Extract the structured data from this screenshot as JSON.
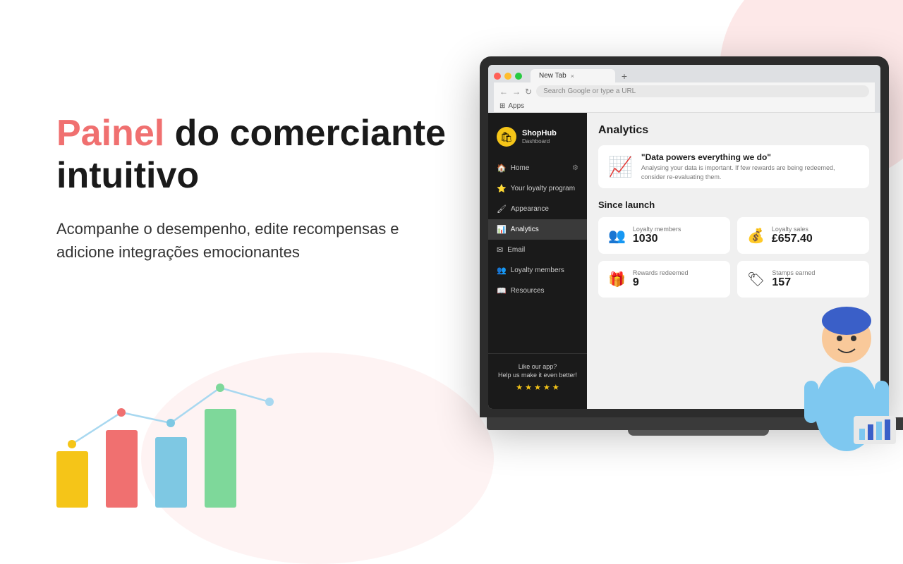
{
  "background": {
    "color": "#ffffff"
  },
  "left": {
    "headline_highlight": "Painel",
    "headline_rest": " do comerciante intuitivo",
    "subtext": "Acompanhe o desempenho, edite recompensas e adicione integrações emocionantes"
  },
  "browser": {
    "tab_label": "New Tab",
    "tab_close": "×",
    "tab_new": "+",
    "address_placeholder": "Search Google or type a URL",
    "apps_label": "Apps",
    "nav_back": "←",
    "nav_forward": "→",
    "nav_refresh": "↻"
  },
  "sidebar": {
    "logo_name": "ShopHub",
    "logo_sub": "Dashboard",
    "nav_items": [
      {
        "id": "home",
        "label": "Home",
        "icon": "🏠",
        "active": false,
        "has_gear": true
      },
      {
        "id": "loyalty",
        "label": "Your loyalty program",
        "icon": "⭐",
        "active": false,
        "has_gear": false
      },
      {
        "id": "appearance",
        "label": "Appearance",
        "icon": "🖌️",
        "active": false,
        "has_gear": false
      },
      {
        "id": "analytics",
        "label": "Analytics",
        "icon": "📊",
        "active": true,
        "has_gear": false
      },
      {
        "id": "email",
        "label": "Email",
        "icon": "✉️",
        "active": false,
        "has_gear": false
      },
      {
        "id": "members",
        "label": "Loyalty members",
        "icon": "👥",
        "active": false,
        "has_gear": false
      },
      {
        "id": "resources",
        "label": "Resources",
        "icon": "📖",
        "active": false,
        "has_gear": false
      }
    ],
    "bottom_text_line1": "Like our app?",
    "bottom_text_line2": "Help us make it even better!",
    "stars": "★ ★ ★ ★ ★"
  },
  "analytics": {
    "title": "Analytics",
    "banner_quote": "\"Data powers everything we do\"",
    "banner_desc": "Analysing your data is important. If few rewards are being redeemed, consider re-evaluating them.",
    "since_launch_label": "Since launch",
    "stats": [
      {
        "id": "loyalty-members",
        "label": "Loyalty members",
        "value": "1030",
        "icon": "👥"
      },
      {
        "id": "loyalty-sales",
        "label": "Loyalty sales",
        "value": "£657.40",
        "icon": "💰"
      },
      {
        "id": "rewards-redeemed",
        "label": "Rewards redeemed",
        "value": "9",
        "icon": "🎁"
      },
      {
        "id": "stamps-earned",
        "label": "Stamps earned",
        "value": "157",
        "icon": "🏷️"
      }
    ]
  }
}
